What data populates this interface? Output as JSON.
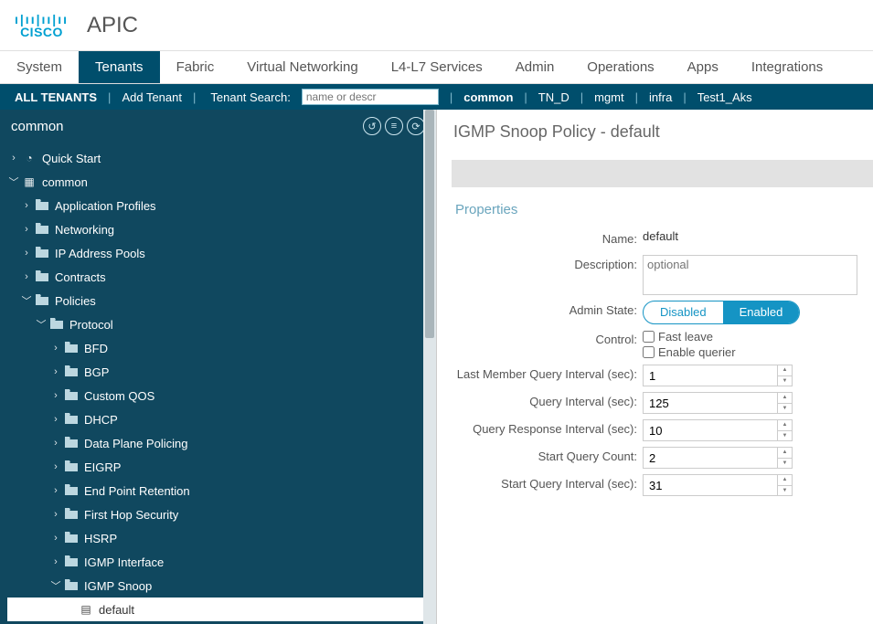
{
  "brand": {
    "logo_top": "ı|ıı|ıı|ıı",
    "logo_text": "CISCO",
    "app": "APIC"
  },
  "nav": {
    "tabs": [
      "System",
      "Tenants",
      "Fabric",
      "Virtual Networking",
      "L4-L7 Services",
      "Admin",
      "Operations",
      "Apps",
      "Integrations"
    ],
    "active": 1
  },
  "subnav": {
    "all": "ALL TENANTS",
    "add": "Add Tenant",
    "search_label": "Tenant Search:",
    "search_placeholder": "name or descr",
    "items": [
      "common",
      "TN_D",
      "mgmt",
      "infra",
      "Test1_Aks"
    ]
  },
  "sidebar": {
    "heading": "common",
    "nodes": {
      "quick": "Quick Start",
      "common": "common",
      "approf": "Application Profiles",
      "netw": "Networking",
      "ippools": "IP Address Pools",
      "contracts": "Contracts",
      "policies": "Policies",
      "protocol": "Protocol",
      "bfd": "BFD",
      "bgp": "BGP",
      "cqos": "Custom QOS",
      "dhcp": "DHCP",
      "dpp": "Data Plane Policing",
      "eigrp": "EIGRP",
      "epr": "End Point Retention",
      "fhs": "First Hop Security",
      "hsrp": "HSRP",
      "igmpif": "IGMP Interface",
      "igmpsn": "IGMP Snoop",
      "default": "default"
    }
  },
  "panel": {
    "title": "IGMP Snoop Policy - default",
    "props_h": "Properties",
    "labels": {
      "name": "Name:",
      "desc": "Description:",
      "admin": "Admin State:",
      "control": "Control:",
      "lmqi": "Last Member Query Interval (sec):",
      "qi": "Query Interval (sec):",
      "qri": "Query Response Interval (sec):",
      "sqc": "Start Query Count:",
      "sqi": "Start Query Interval (sec):"
    },
    "values": {
      "name": "default",
      "desc_ph": "optional",
      "admin_disabled": "Disabled",
      "admin_enabled": "Enabled",
      "fast_leave": "Fast leave",
      "enable_querier": "Enable querier",
      "lmqi": "1",
      "qi": "125",
      "qri": "10",
      "sqc": "2",
      "sqi": "31"
    }
  }
}
